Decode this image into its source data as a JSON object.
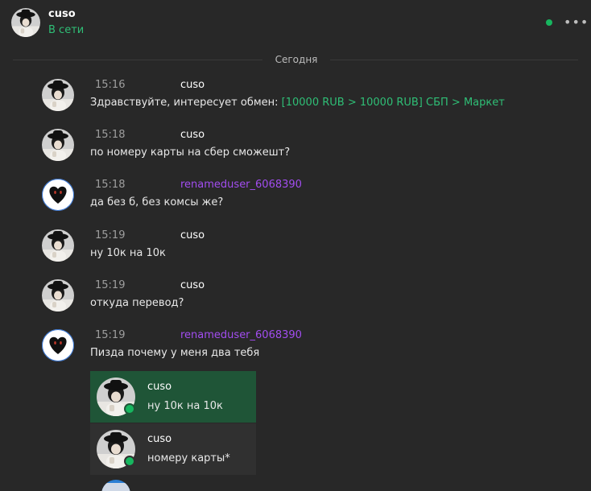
{
  "colors": {
    "background": "#282828",
    "user_cuso_name": "#ffffff",
    "user_renamed_name": "#a24df0",
    "accent_green": "#2fbf76",
    "status_online": "#17b65f",
    "quote_active_bg": "#1f5537"
  },
  "header": {
    "name": "cuso",
    "status": "В сети",
    "more_icon": "more-horizontal-icon"
  },
  "date_divider": "Сегодня",
  "messages": [
    {
      "author": "cuso",
      "time": "15:16",
      "text_prefix": "Здравствуйте, интересует обмен: ",
      "text_link": "[10000 RUB > 10000 RUB] СБП > Маркет"
    },
    {
      "author": "cuso",
      "time": "15:18",
      "text": "по номеру карты на сбер сможешт?"
    },
    {
      "author": "renameduser_6068390",
      "time": "15:18",
      "text": "да без б, без комсы же?"
    },
    {
      "author": "cuso",
      "time": "15:19",
      "text": "ну 10к на 10к"
    },
    {
      "author": "cuso",
      "time": "15:19",
      "text": "откуда перевод?"
    },
    {
      "author": "renameduser_6068390",
      "time": "15:19",
      "text": "Пизда почему у меня два тебя"
    }
  ],
  "quotes": [
    {
      "author": "cuso",
      "text": "ну 10к на 10к",
      "active": true
    },
    {
      "author": "cuso",
      "text": "номеру карты*",
      "active": false
    }
  ]
}
